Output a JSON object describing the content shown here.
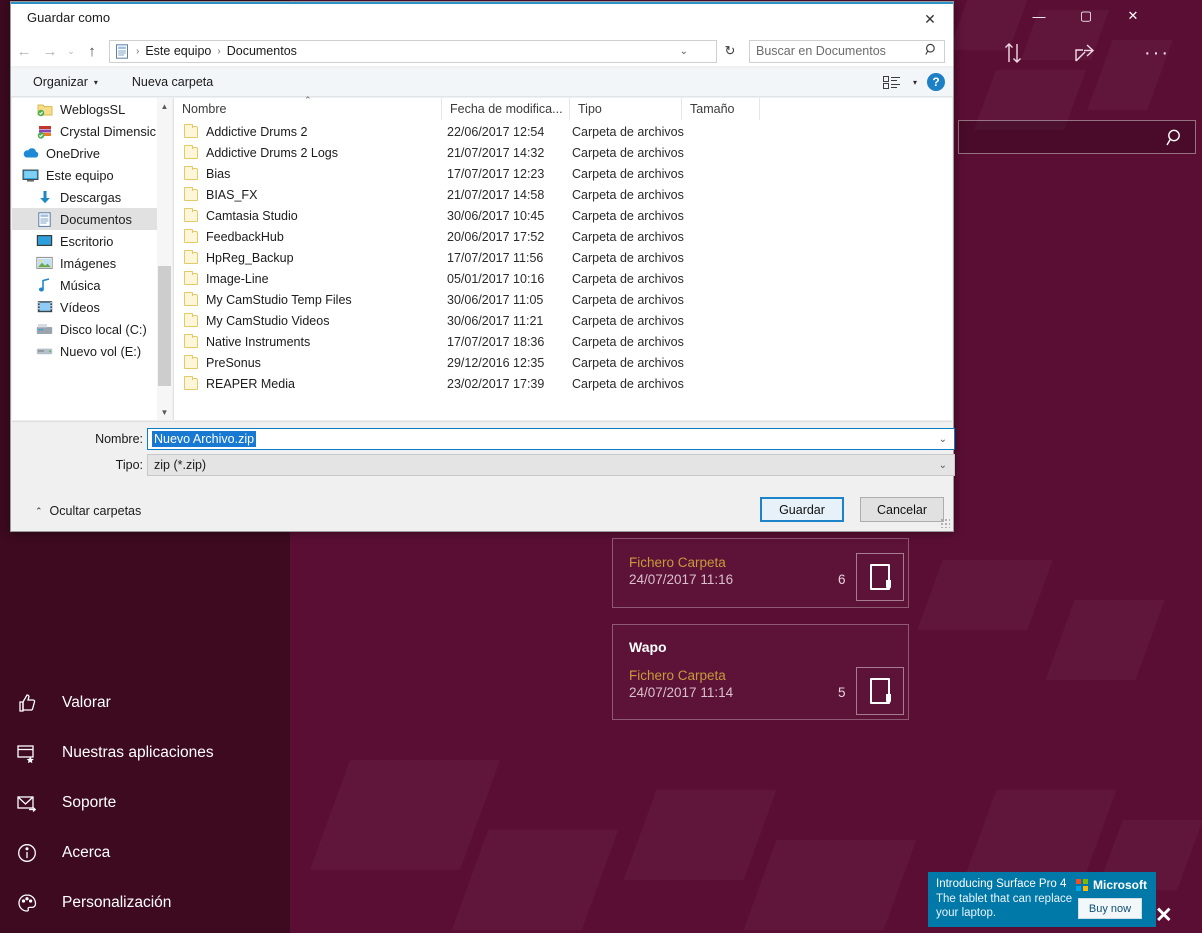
{
  "background_app": {
    "window_controls": {
      "minimize": "—",
      "maximize": "▢",
      "close": "✕"
    },
    "toolbar_icons": [
      "checklist-icon",
      "sort-icon",
      "share-icon",
      "more-icon"
    ],
    "search": {
      "placeholder": "",
      "icon": "search-icon"
    },
    "nav_items": [
      {
        "label": "Valorar",
        "icon": "thumbs-up-icon"
      },
      {
        "label": "Nuestras aplicaciones",
        "icon": "apps-star-icon"
      },
      {
        "label": "Soporte",
        "icon": "mail-icon"
      },
      {
        "label": "Acerca",
        "icon": "info-icon"
      },
      {
        "label": "Personalización",
        "icon": "palette-icon"
      }
    ],
    "cards": [
      {
        "title": "",
        "type": "Fichero Carpeta",
        "date": "24/07/2017 11:16",
        "count": "6"
      },
      {
        "title": "Wapo",
        "type": "Fichero Carpeta",
        "date": "24/07/2017 11:14",
        "count": "5"
      }
    ],
    "colors": {
      "panel": "#3d0a20",
      "main": "#5a0e33",
      "accent_orange": "#c79a3c"
    }
  },
  "ad": {
    "headline": "Introducing Surface Pro 4",
    "subline_1": "The tablet that can replace",
    "subline_2": "your laptop.",
    "brand": "Microsoft",
    "button": "Buy now",
    "close": "✕",
    "color": "#0078a8"
  },
  "dialog": {
    "title": "Guardar como",
    "close": "✕",
    "nav": {
      "back": "←",
      "forward": "→",
      "recent": "⌄",
      "up": "↑",
      "breadcrumb": [
        "Este equipo",
        "Documentos"
      ],
      "separator": "›",
      "dropdown": "⌄",
      "refresh": "↻"
    },
    "search": {
      "placeholder": "Buscar en Documentos",
      "icon": "search-icon"
    },
    "toolbar": {
      "organize": "Organizar",
      "new_folder": "Nueva carpeta",
      "caret": "▾",
      "view_icon": "view-list-icon",
      "view_caret": "▾",
      "help": "?"
    },
    "tree": [
      {
        "label": "WeblogsSL",
        "icon": "folder-sync-icon",
        "indent": true,
        "selected": false
      },
      {
        "label": "Crystal Dimensic",
        "icon": "books-sync-icon",
        "indent": true,
        "selected": false
      },
      {
        "label": "OneDrive",
        "icon": "onedrive-icon",
        "indent": false,
        "selected": false
      },
      {
        "label": "Este equipo",
        "icon": "computer-icon",
        "indent": false,
        "selected": false
      },
      {
        "label": "Descargas",
        "icon": "downloads-icon",
        "indent": true,
        "selected": false
      },
      {
        "label": "Documentos",
        "icon": "documents-icon",
        "indent": true,
        "selected": true
      },
      {
        "label": "Escritorio",
        "icon": "desktop-icon",
        "indent": true,
        "selected": false
      },
      {
        "label": "Imágenes",
        "icon": "pictures-icon",
        "indent": true,
        "selected": false
      },
      {
        "label": "Música",
        "icon": "music-icon",
        "indent": true,
        "selected": false
      },
      {
        "label": "Vídeos",
        "icon": "videos-icon",
        "indent": true,
        "selected": false
      },
      {
        "label": "Disco local (C:)",
        "icon": "disk-icon",
        "indent": true,
        "selected": false
      },
      {
        "label": "Nuevo vol (E:)",
        "icon": "drive-icon",
        "indent": true,
        "selected": false
      }
    ],
    "columns": {
      "name": "Nombre",
      "date": "Fecha de modifica...",
      "type": "Tipo",
      "size": "Tamaño",
      "sort_caret": "⌃"
    },
    "files": [
      {
        "name": "Addictive Drums 2",
        "date": "22/06/2017 12:54",
        "type": "Carpeta de archivos",
        "size": ""
      },
      {
        "name": "Addictive Drums 2 Logs",
        "date": "21/07/2017 14:32",
        "type": "Carpeta de archivos",
        "size": ""
      },
      {
        "name": "Bias",
        "date": "17/07/2017 12:23",
        "type": "Carpeta de archivos",
        "size": ""
      },
      {
        "name": "BIAS_FX",
        "date": "21/07/2017 14:58",
        "type": "Carpeta de archivos",
        "size": ""
      },
      {
        "name": "Camtasia Studio",
        "date": "30/06/2017 10:45",
        "type": "Carpeta de archivos",
        "size": ""
      },
      {
        "name": "FeedbackHub",
        "date": "20/06/2017 17:52",
        "type": "Carpeta de archivos",
        "size": ""
      },
      {
        "name": "HpReg_Backup",
        "date": "17/07/2017 11:56",
        "type": "Carpeta de archivos",
        "size": ""
      },
      {
        "name": "Image-Line",
        "date": "05/01/2017 10:16",
        "type": "Carpeta de archivos",
        "size": ""
      },
      {
        "name": "My CamStudio Temp Files",
        "date": "30/06/2017 11:05",
        "type": "Carpeta de archivos",
        "size": ""
      },
      {
        "name": "My CamStudio Videos",
        "date": "30/06/2017 11:21",
        "type": "Carpeta de archivos",
        "size": ""
      },
      {
        "name": "Native Instruments",
        "date": "17/07/2017 18:36",
        "type": "Carpeta de archivos",
        "size": ""
      },
      {
        "name": "PreSonus",
        "date": "29/12/2016 12:35",
        "type": "Carpeta de archivos",
        "size": ""
      },
      {
        "name": "REAPER Media",
        "date": "23/02/2017 17:39",
        "type": "Carpeta de archivos",
        "size": ""
      }
    ],
    "form": {
      "name_label": "Nombre:",
      "name_value": "Nuevo Archivo.zip",
      "type_label": "Tipo:",
      "type_value": "zip (*.zip)",
      "caret": "⌄",
      "hide_folders": "Ocultar carpetas",
      "hide_caret": "⌃",
      "save": "Guardar",
      "cancel": "Cancelar"
    }
  }
}
